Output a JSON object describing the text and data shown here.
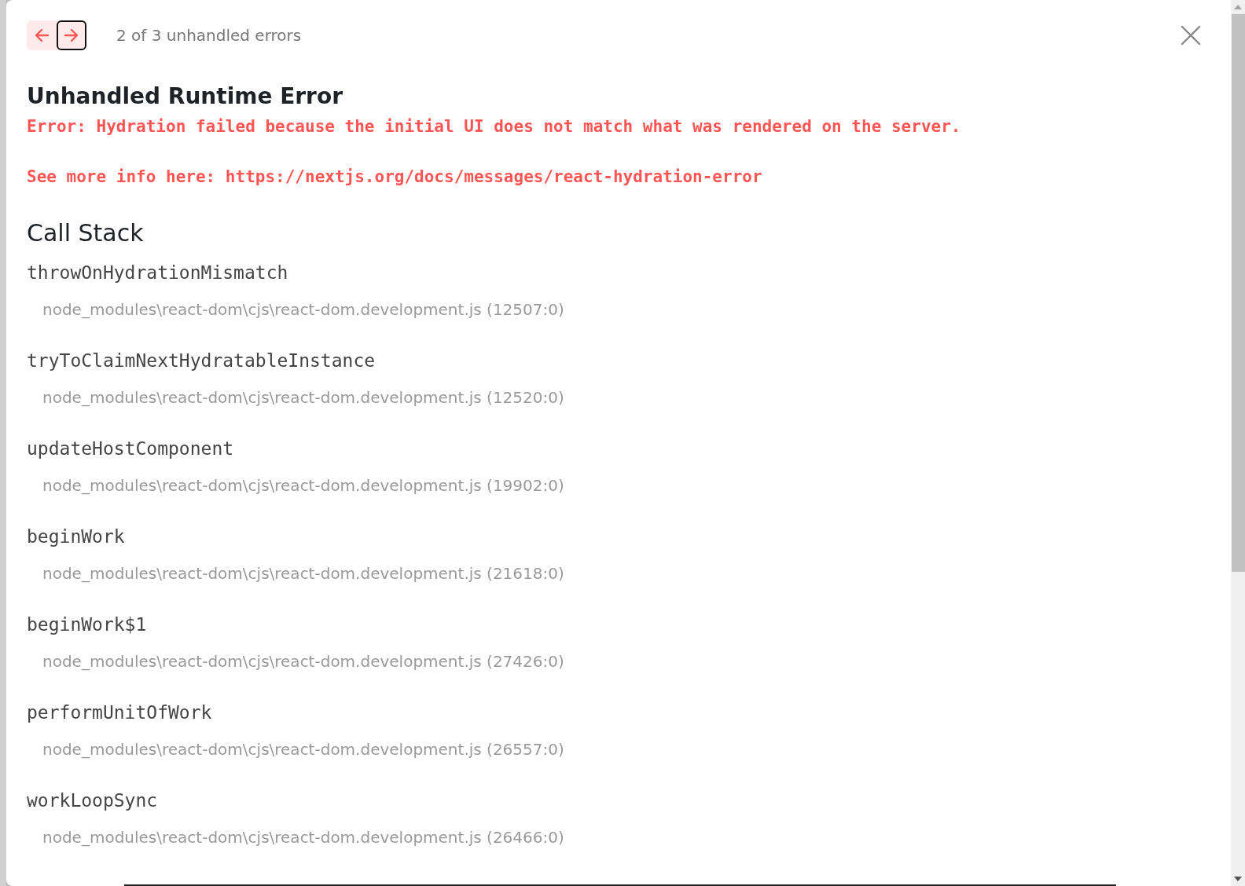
{
  "nav": {
    "buttons": [
      {
        "kind": "previous",
        "focused": false
      },
      {
        "kind": "next",
        "focused": true
      }
    ],
    "counter": "2 of 3 unhandled errors"
  },
  "title": "Unhandled Runtime Error",
  "message": [
    "Error: Hydration failed because the initial UI does not match what was rendered on the server.",
    "See more info here: https://nextjs.org/docs/messages/react-hydration-error"
  ],
  "call_stack": {
    "heading": "Call Stack",
    "frames": [
      {
        "function": "throwOnHydrationMismatch",
        "location": "node_modules\\react-dom\\cjs\\react-dom.development.js (12507:0)"
      },
      {
        "function": "tryToClaimNextHydratableInstance",
        "location": "node_modules\\react-dom\\cjs\\react-dom.development.js (12520:0)"
      },
      {
        "function": "updateHostComponent",
        "location": "node_modules\\react-dom\\cjs\\react-dom.development.js (19902:0)"
      },
      {
        "function": "beginWork",
        "location": "node_modules\\react-dom\\cjs\\react-dom.development.js (21618:0)"
      },
      {
        "function": "beginWork$1",
        "location": "node_modules\\react-dom\\cjs\\react-dom.development.js (27426:0)"
      },
      {
        "function": "performUnitOfWork",
        "location": "node_modules\\react-dom\\cjs\\react-dom.development.js (26557:0)"
      },
      {
        "function": "workLoopSync",
        "location": "node_modules\\react-dom\\cjs\\react-dom.development.js (26466:0)"
      }
    ]
  }
}
